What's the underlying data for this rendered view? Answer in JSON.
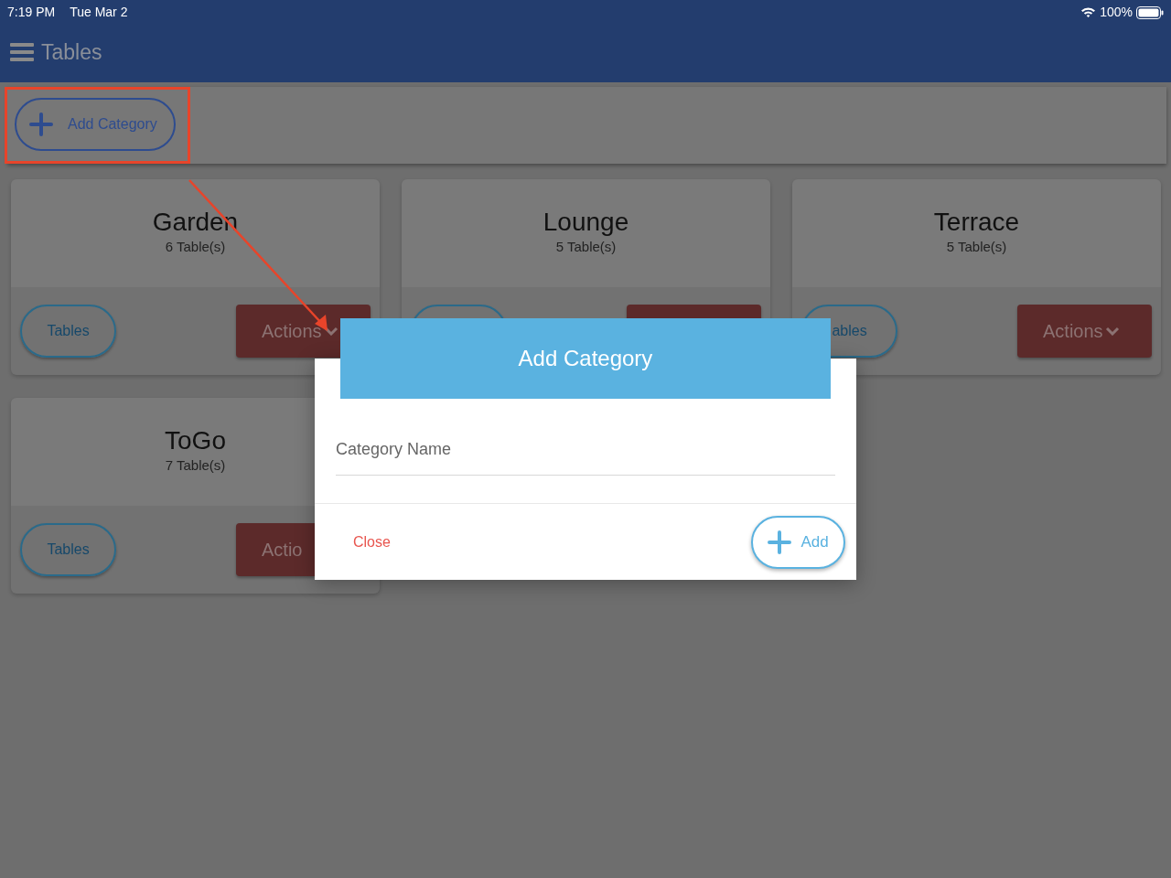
{
  "status_bar": {
    "time": "7:19 PM",
    "date": "Tue Mar 2",
    "battery": "100%"
  },
  "app_bar": {
    "title": "Tables"
  },
  "toolbar": {
    "add_button": "Add Category"
  },
  "categories": [
    {
      "name": "Garden",
      "count": "6 Table(s)",
      "buttons": [
        {
          "kind": "tables",
          "label": "Tables"
        },
        {
          "kind": "actions",
          "label": "Actions",
          "chevron": true
        }
      ]
    },
    {
      "name": "Lounge",
      "count": "5 Table(s)",
      "buttons": [
        {
          "kind": "tables"
        },
        {
          "kind": "actions"
        }
      ]
    },
    {
      "name": "Terrace",
      "count": "5 Table(s)",
      "buttons": [
        {
          "kind": "tables",
          "label": "ables"
        },
        {
          "kind": "actions",
          "label": "Actions",
          "chevron": true
        }
      ]
    },
    {
      "name": "ToGo",
      "count": "7 Table(s)",
      "buttons": [
        {
          "kind": "tables",
          "label": "Tables"
        },
        {
          "kind": "actions",
          "label": "Actio",
          "chevron": false,
          "covered": true
        }
      ]
    }
  ],
  "dialog": {
    "title": "Add Category",
    "field": {
      "placeholder": "Category Name"
    },
    "close_button": "Close",
    "add_button": "Add"
  },
  "annotation": {
    "box": true,
    "arrow": true
  }
}
